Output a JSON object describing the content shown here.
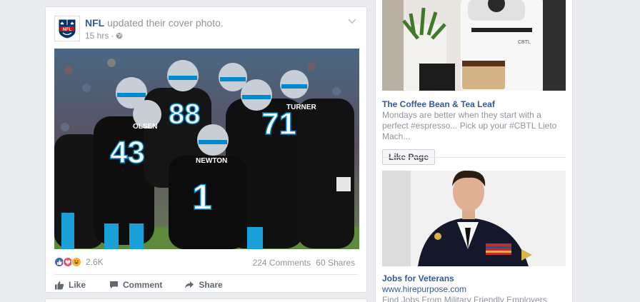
{
  "post": {
    "author": "NFL",
    "action": "updated their cover photo.",
    "time": "15 hrs",
    "reactions": {
      "count": "2.6K"
    },
    "comments": "224 Comments",
    "shares": "60 Shares",
    "photo": {
      "players": [
        "43",
        "1",
        "71",
        "88"
      ],
      "names": [
        "NEWTON",
        "TURNER",
        "OLSEN"
      ]
    },
    "actions": {
      "like": "Like",
      "comment": "Comment",
      "share": "Share"
    }
  },
  "ads": [
    {
      "title": "The Coffee Bean & Tea Leaf",
      "body": "Mondays are better when they start with a perfect #espresso... Pick up your #CBTL Lieto Mach...",
      "button": "Like Page",
      "machine_label": "CBTL"
    },
    {
      "title": "Jobs for Veterans",
      "url": "www.hirepurpose.com",
      "body": "Find Jobs From Military Friendly Employers Hiring"
    }
  ],
  "colors": {
    "link": "#365899",
    "muted": "#90949c",
    "like": "#4267b2",
    "love": "#f25268",
    "haha": "#f7b125"
  }
}
